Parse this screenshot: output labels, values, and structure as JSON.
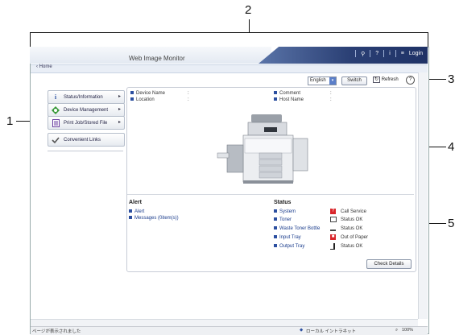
{
  "callouts": [
    "1",
    "2",
    "3",
    "4",
    "5"
  ],
  "window": {
    "title": "Web Image Monitor",
    "home_link": "Home",
    "login_label": "Login",
    "toolbar_icons": [
      "search-icon",
      "help-icon",
      "info-icon",
      "menu-icon"
    ]
  },
  "nav": {
    "items": [
      {
        "label": "Status/Information",
        "icon": "info-icon"
      },
      {
        "label": "Device Management",
        "icon": "device-management-icon"
      },
      {
        "label": "Print Job/Stored File",
        "icon": "document-icon"
      },
      {
        "label": "Convenient Links",
        "icon": "link-check-icon"
      }
    ]
  },
  "controls": {
    "language": "English",
    "switch_label": "Switch",
    "refresh_label": "Refresh",
    "help_label": "?"
  },
  "device_info": {
    "device_name_label": "Device Name",
    "location_label": "Location",
    "comment_label": "Comment",
    "host_name_label": "Host Name",
    "separator": ":"
  },
  "alert": {
    "heading": "Alert",
    "links": [
      "Alert",
      "Messages (0item(s))"
    ]
  },
  "status": {
    "heading": "Status",
    "rows": [
      {
        "label": "System",
        "value": "Call Service",
        "icon_color": "#d9262b"
      },
      {
        "label": "Toner",
        "value": "Status OK",
        "icon_color": "#444444"
      },
      {
        "label": "Waste Toner Bottle",
        "value": "Status OK",
        "icon_color": "#444444"
      },
      {
        "label": "Input Tray",
        "value": "Out of Paper",
        "icon_color": "#d9262b"
      },
      {
        "label": "Output Tray",
        "value": "Status OK",
        "icon_color": "#222222"
      }
    ],
    "check_details_label": "Check Details"
  },
  "statusbar": {
    "left_text": "ページが表示されました",
    "zone_text": "ローカル イントラネット",
    "zoom_text": "100%"
  },
  "colors": {
    "accent": "#2c4fa0",
    "topbar_dark": "#1f3266",
    "error": "#d9262b"
  }
}
